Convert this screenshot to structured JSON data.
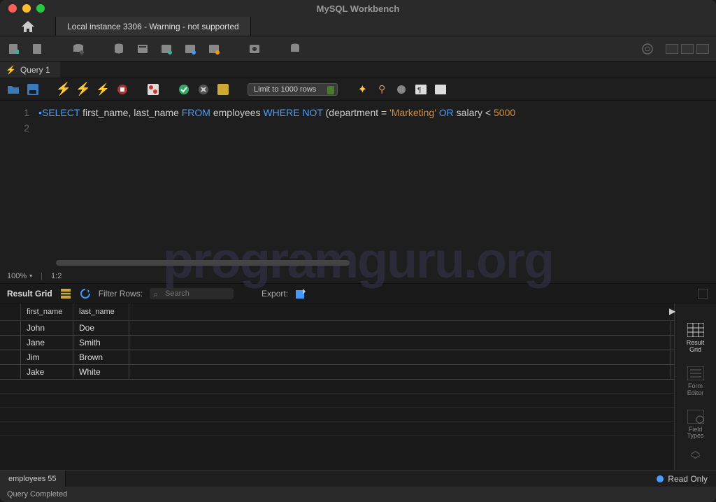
{
  "window": {
    "title": "MySQL Workbench"
  },
  "connection_tab": "Local instance 3306 - Warning - not supported",
  "query_tab": "Query 1",
  "limit_select": "Limit to 1000 rows",
  "editor": {
    "line1": {
      "p1": "SELECT",
      "p2": " first_name, last_name ",
      "p3": "FROM",
      "p4": " employees ",
      "p5": "WHERE NOT",
      "p6": " (department = ",
      "p7": "'Marketing'",
      "p8": " ",
      "p9": "OR",
      "p10": " salary < ",
      "p11": "5000"
    },
    "gutter": [
      "1",
      "2"
    ]
  },
  "zoom": "100%",
  "cursor": "1:2",
  "result": {
    "label": "Result Grid",
    "filter_label": "Filter Rows:",
    "filter_placeholder": "Search",
    "export_label": "Export:",
    "columns": [
      "first_name",
      "last_name"
    ],
    "rows": [
      {
        "first_name": "John",
        "last_name": "Doe"
      },
      {
        "first_name": "Jane",
        "last_name": "Smith"
      },
      {
        "first_name": "Jim",
        "last_name": "Brown"
      },
      {
        "first_name": "Jake",
        "last_name": "White"
      }
    ]
  },
  "side": {
    "grid": "Result\nGrid",
    "form": "Form\nEditor",
    "types": "Field\nTypes"
  },
  "bottom_tab": "employees 55",
  "readonly": "Read Only",
  "status": "Query Completed",
  "watermark": "programguru.org"
}
